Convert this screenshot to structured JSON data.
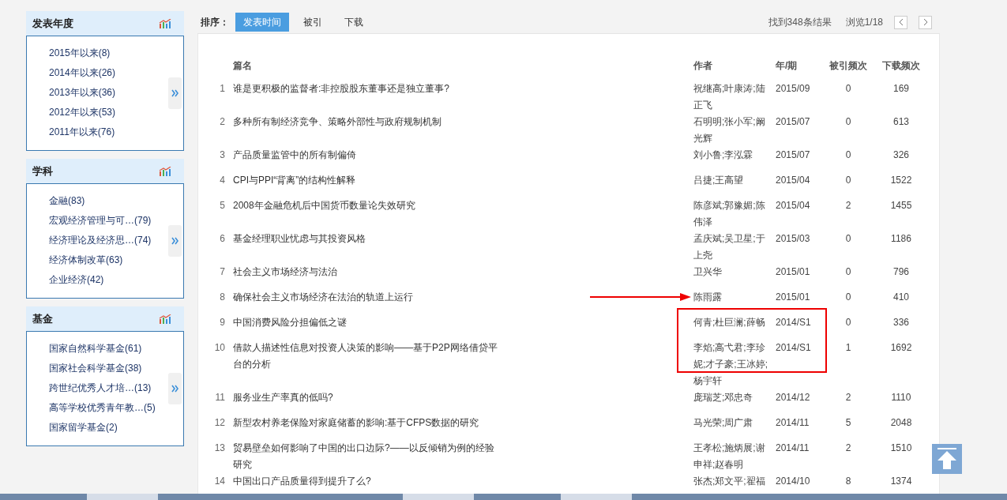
{
  "sidebar": {
    "sections": [
      {
        "title": "发表年度",
        "items": [
          "2015年以来(8)",
          "2014年以来(26)",
          "2013年以来(36)",
          "2012年以来(53)",
          "2011年以来(76)"
        ]
      },
      {
        "title": "学科",
        "items": [
          "金融(83)",
          "宏观经济管理与可…(79)",
          "经济理论及经济思…(74)",
          "经济体制改革(63)",
          "企业经济(42)"
        ]
      },
      {
        "title": "基金",
        "items": [
          "国家自然科学基金(61)",
          "国家社会科学基金(38)",
          "跨世纪优秀人才培…(13)",
          "高等学校优秀青年教…(5)",
          "国家留学基金(2)"
        ]
      }
    ]
  },
  "sort": {
    "label": "排序：",
    "options": [
      {
        "label": "发表时间",
        "selected": true
      },
      {
        "label": "被引",
        "selected": false
      },
      {
        "label": "下载",
        "selected": false
      }
    ]
  },
  "results": {
    "count": "找到348条结果",
    "page": "浏览1/18"
  },
  "table": {
    "columns": [
      "篇名",
      "作者",
      "年/期",
      "被引频次",
      "下载频次"
    ],
    "rows": [
      {
        "no": "1",
        "title": "谁是更积极的监督者:非控股股东董事还是独立董事?",
        "authors": "祝继高;叶康涛;陆正飞",
        "year": "2015/09",
        "cited": "0",
        "downloads": "169"
      },
      {
        "no": "2",
        "title": "多种所有制经济竞争、策略外部性与政府规制机制",
        "authors": "石明明;张小军;阚光辉",
        "year": "2015/07",
        "cited": "0",
        "downloads": "613"
      },
      {
        "no": "3",
        "title": "产品质量监管中的所有制偏倚",
        "authors": "刘小鲁;李泓霖",
        "year": "2015/07",
        "cited": "0",
        "downloads": "326"
      },
      {
        "no": "4",
        "title": "CPI与PPI“背离”的结构性解释",
        "authors": "吕捷;王高望",
        "year": "2015/04",
        "cited": "0",
        "downloads": "1522"
      },
      {
        "no": "5",
        "title": "2008年金融危机后中国货币数量论失效研究",
        "authors": "陈彦斌;郭豫媚;陈伟泽",
        "year": "2015/04",
        "cited": "2",
        "downloads": "1455"
      },
      {
        "no": "6",
        "title": "基金经理职业忧虑与其投资风格",
        "authors": "孟庆斌;吴卫星;于上尧",
        "year": "2015/03",
        "cited": "0",
        "downloads": "1186"
      },
      {
        "no": "7",
        "title": "社会主义市场经济与法治",
        "authors": "卫兴华",
        "year": "2015/01",
        "cited": "0",
        "downloads": "796"
      },
      {
        "no": "8",
        "title": "确保社会主义市场经济在法治的轨道上运行",
        "authors": "陈雨露",
        "year": "2015/01",
        "cited": "0",
        "downloads": "410"
      },
      {
        "no": "9",
        "title": "中国消费风险分担偏低之谜",
        "authors": "何青;杜巨澜;薛畅",
        "year": "2014/S1",
        "cited": "0",
        "downloads": "336"
      },
      {
        "no": "10",
        "title": "借款人描述性信息对投资人决策的影响——基于P2P网络借贷平台的分析",
        "authors": "李焰;高弋君;李珍妮;才子豪;王冰婷;杨宇轩",
        "year": "2014/S1",
        "cited": "1",
        "downloads": "1692"
      },
      {
        "no": "11",
        "title": "服务业生产率真的低吗?",
        "authors": "庞瑞芝;邓忠奇",
        "year": "2014/12",
        "cited": "2",
        "downloads": "1110"
      },
      {
        "no": "12",
        "title": "新型农村养老保险对家庭储蓄的影响:基于CFPS数据的研究",
        "authors": "马光荣;周广肃",
        "year": "2014/11",
        "cited": "5",
        "downloads": "2048"
      },
      {
        "no": "13",
        "title": "贸易壁垒如何影响了中国的出口边际?——以反倾销为例的经验研究",
        "authors": "王孝松;施炳展;谢申祥;赵春明",
        "year": "2014/11",
        "cited": "2",
        "downloads": "1510"
      },
      {
        "no": "14",
        "title": "中国出口产品质量得到提升了么?",
        "authors": "张杰;郑文平;翟福",
        "year": "2014/10",
        "cited": "8",
        "downloads": "1374"
      }
    ]
  }
}
